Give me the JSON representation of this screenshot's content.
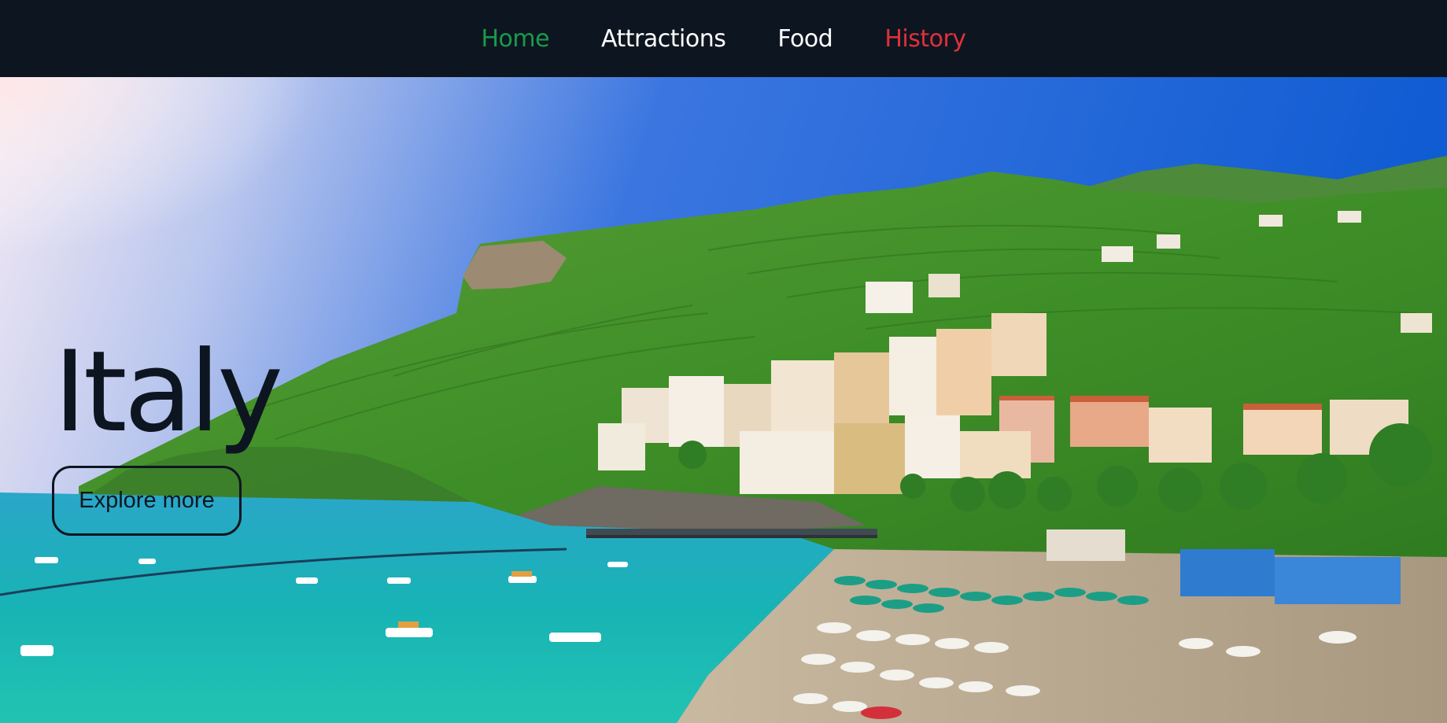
{
  "nav": {
    "items": [
      {
        "label": "Home",
        "color": "#1a9a4a"
      },
      {
        "label": "Attractions",
        "color": "#ffffff"
      },
      {
        "label": "Food",
        "color": "#ffffff"
      },
      {
        "label": "History",
        "color": "#e0303c"
      }
    ]
  },
  "hero": {
    "title": "Italy",
    "button_label": "Explore more"
  },
  "colors": {
    "background": "#0d1620",
    "sky_top": "#1a5fd6",
    "sea": "#1fb0b8",
    "hills": "#3f8f28"
  }
}
